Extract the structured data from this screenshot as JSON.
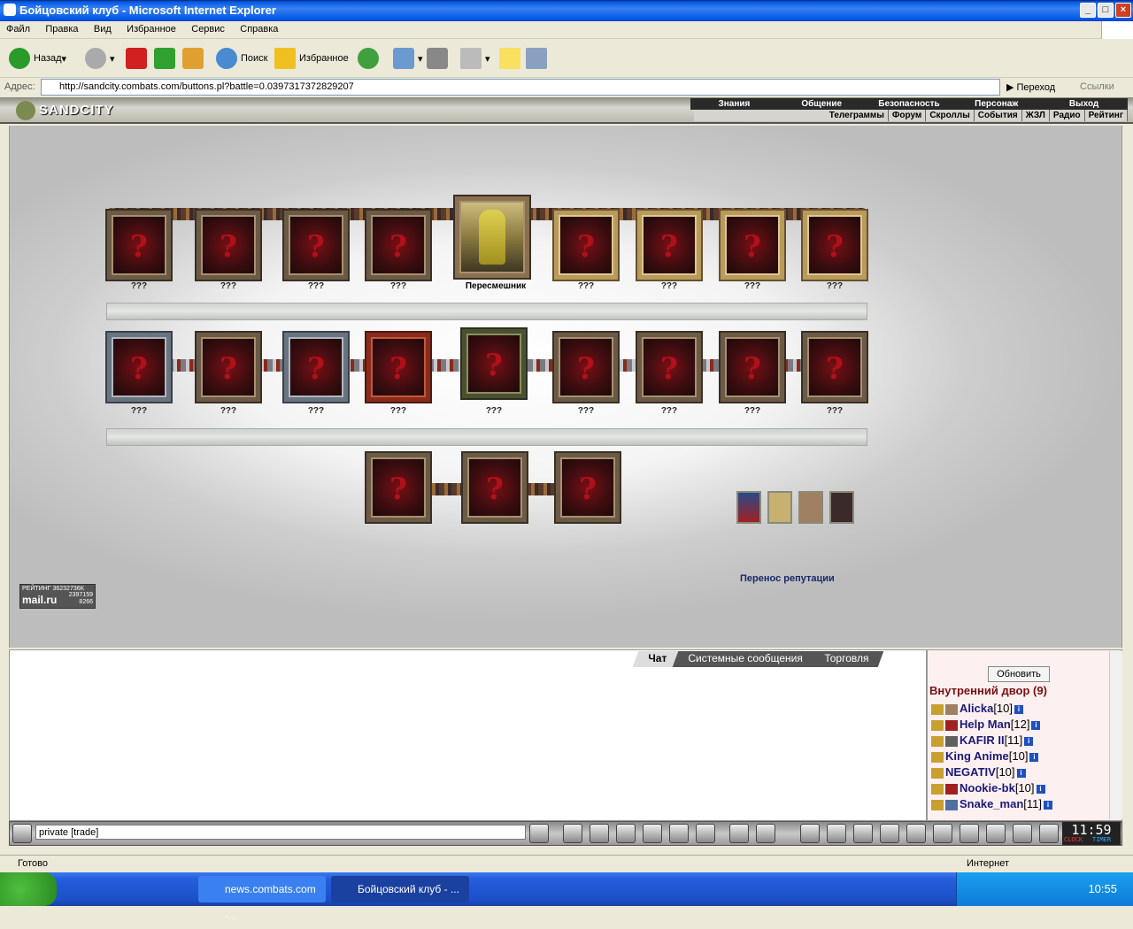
{
  "window": {
    "title": "Бойцовский клуб - Microsoft Internet Explorer"
  },
  "menu": [
    "Файл",
    "Правка",
    "Вид",
    "Избранное",
    "Сервис",
    "Справка"
  ],
  "toolbar": {
    "back_label": "Назад",
    "search_label": "Поиск",
    "favorites_label": "Избранное"
  },
  "address": {
    "label": "Адрес:",
    "url": "http://sandcity.combats.com/buttons.pl?battle=0.0397317372829207",
    "go_label": "Переход",
    "links_label": "Ссылки"
  },
  "game": {
    "logo": "SANDCITY",
    "top_nav": [
      "Знания",
      "Общение",
      "Безопасность",
      "Персонаж",
      "Выход"
    ],
    "sub_nav": [
      "Телеграммы",
      "Форум",
      "Скроллы",
      "События",
      "ЖЗЛ",
      "Радио",
      "Рейтинг"
    ],
    "row1_labels": [
      "???",
      "???",
      "???",
      "???",
      "???",
      "???",
      "???",
      "???"
    ],
    "character_name": "Пересмешник",
    "row2_labels": [
      "???",
      "???",
      "???",
      "???",
      "???",
      "???",
      "???",
      "???",
      "???"
    ],
    "reputation_link": "Перенос репутации",
    "rating": {
      "title": "РЕЙТИНГ",
      "n1": "36232736K",
      "brand": "mail.ru",
      "n2": "2397159",
      "n3": "8266"
    }
  },
  "chat": {
    "tabs": [
      "Чат",
      "Системные сообщения",
      "Торговля"
    ],
    "input_value": "private [trade]"
  },
  "users_panel": {
    "refresh_label": "Обновить",
    "room_title": "Внутренний двор (9)",
    "users": [
      {
        "name": "Alicka",
        "level": "[10]"
      },
      {
        "name": "Help Man",
        "level": "[12]"
      },
      {
        "name": "KAFIR II",
        "level": "[11]"
      },
      {
        "name": "King Anime",
        "level": "[10]"
      },
      {
        "name": "NEGATIV",
        "level": "[10]"
      },
      {
        "name": "Nookie-bk",
        "level": "[10]"
      },
      {
        "name": "Snake_man",
        "level": "[11]"
      }
    ]
  },
  "clock": {
    "time": "11:59",
    "label_clock": "CLOCK",
    "label_timer": "TIMER"
  },
  "statusbar": {
    "left": "Готово",
    "right": "Интернет"
  },
  "taskbar": {
    "task1": "news.combats.com -...",
    "task2": "Бойцовский клуб - ...",
    "time": "10:55"
  }
}
